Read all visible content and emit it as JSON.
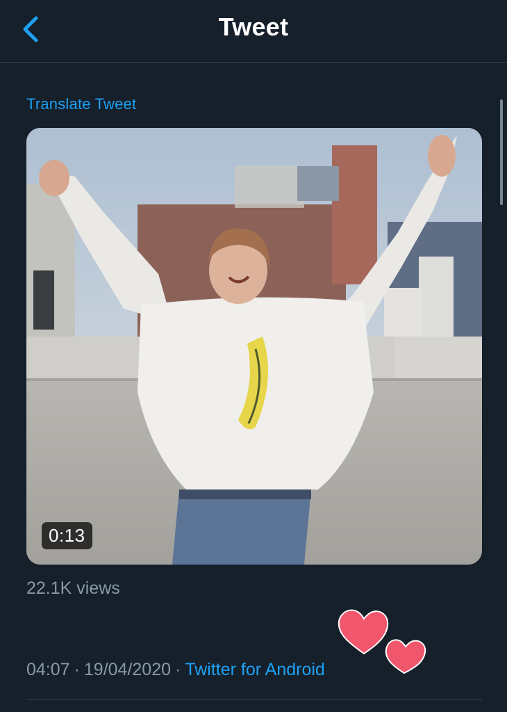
{
  "header": {
    "title": "Tweet",
    "back_icon": "chevron-left-icon"
  },
  "tweet": {
    "translate_label": "Translate Tweet",
    "video": {
      "duration": "0:13"
    },
    "views": {
      "count": "22.1K",
      "label": "views"
    },
    "meta": {
      "time": "04:07",
      "separator": "·",
      "date": "19/04/2020",
      "source": "Twitter for Android"
    }
  },
  "decorations": {
    "sticker": "two-red-hearts"
  },
  "colors": {
    "background": "#15202b",
    "accent": "#1da1f2",
    "secondary_text": "#8899a6",
    "divider": "#38444d",
    "heart": "#f0566c"
  }
}
